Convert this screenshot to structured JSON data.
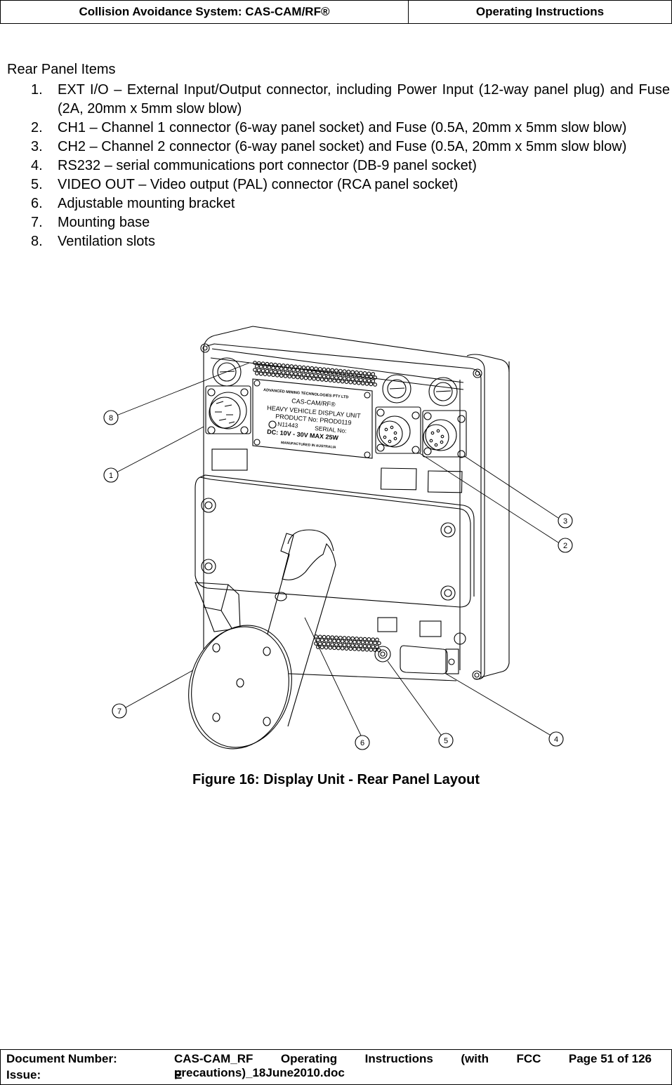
{
  "header": {
    "left": "Collision Avoidance System: CAS-CAM/RF®",
    "right": "Operating Instructions"
  },
  "section_title": "Rear Panel Items",
  "items": [
    {
      "num": "1.",
      "text": "EXT I/O – External Input/Output connector, including Power Input (12-way panel plug) and Fuse (2A, 20mm x 5mm slow blow)"
    },
    {
      "num": "2.",
      "text": "CH1 – Channel 1 connector (6-way panel socket) and Fuse (0.5A, 20mm x 5mm slow blow)"
    },
    {
      "num": "3.",
      "text": "CH2 – Channel 2 connector (6-way panel socket) and Fuse (0.5A, 20mm x 5mm slow blow)"
    },
    {
      "num": "4.",
      "text": "RS232 – serial communications port connector (DB-9 panel socket)"
    },
    {
      "num": "5.",
      "text": "VIDEO OUT – Video output (PAL) connector (RCA panel socket)"
    },
    {
      "num": "6.",
      "text": "Adjustable mounting bracket"
    },
    {
      "num": "7.",
      "text": "Mounting base"
    },
    {
      "num": "8.",
      "text": "Ventilation slots"
    }
  ],
  "figure": {
    "label_plate": {
      "company": "ADVANCED MINING TECHNOLOGIES PTY LTD",
      "product": "CAS-CAM/RF®",
      "unit": "HEAVY VEHICLE DISPLAY UNIT",
      "product_no": "PRODUCT No: PROD0119",
      "cert": "N11443",
      "serial": "SERIAL No:",
      "power": "DC: 10V - 30V  MAX  25W",
      "origin": "MANUFACTURED IN AUSTRALIA"
    },
    "callouts": [
      "1",
      "2",
      "3",
      "4",
      "5",
      "6",
      "7",
      "8"
    ],
    "caption": "Figure 16:  Display Unit - Rear Panel Layout"
  },
  "footer": {
    "doc_number_label": "Document Number:",
    "doc_number_words": [
      "CAS-CAM_RF",
      "Operating",
      "Instructions",
      "(with",
      "FCC"
    ],
    "doc_number_line2": "precautions)_18June2010.doc",
    "page": "Page 51 of  126",
    "issue_label": "Issue:",
    "issue_value": "E"
  }
}
